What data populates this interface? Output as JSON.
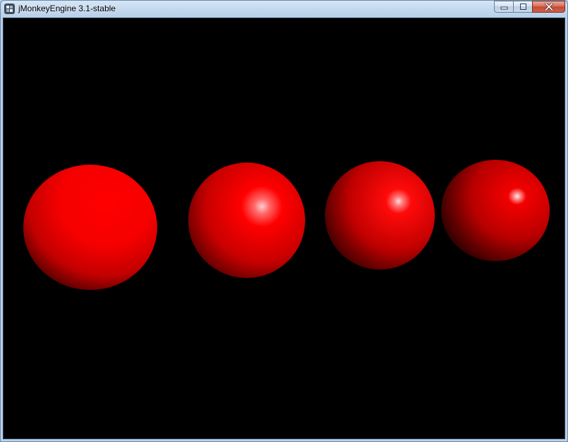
{
  "window": {
    "title": "jMonkeyEngine 3.1-stable",
    "controls": {
      "minimize_icon": "minimize-icon",
      "maximize_icon": "maximize-icon",
      "close_icon": "close-icon"
    }
  },
  "scene": {
    "background_color": "#000000",
    "sphere_color": "#ff0000",
    "spheres": [
      {
        "name": "sphere-1",
        "specular": "none"
      },
      {
        "name": "sphere-2",
        "specular": "broad"
      },
      {
        "name": "sphere-3",
        "specular": "medium"
      },
      {
        "name": "sphere-4",
        "specular": "tight"
      }
    ]
  }
}
